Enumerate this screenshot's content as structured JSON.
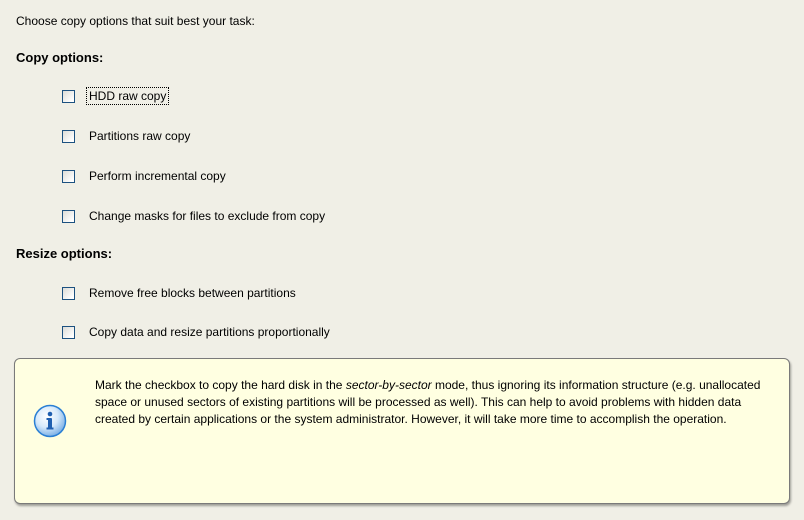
{
  "intro": "Choose copy options that suit best your task:",
  "copy_section": {
    "title": "Copy options:",
    "options": [
      {
        "label": "HDD raw copy",
        "checked": false,
        "focused": true
      },
      {
        "label": "Partitions raw copy",
        "checked": false,
        "focused": false
      },
      {
        "label": "Perform incremental copy",
        "checked": false,
        "focused": false
      },
      {
        "label": "Change masks for files to exclude from copy",
        "checked": false,
        "focused": false
      }
    ]
  },
  "resize_section": {
    "title": "Resize options:",
    "options": [
      {
        "label": "Remove free blocks between partitions",
        "checked": false,
        "focused": false
      },
      {
        "label": "Copy data and resize partitions proportionally",
        "checked": false,
        "focused": false
      }
    ]
  },
  "info": {
    "icon": "info-icon",
    "text_before": "Mark the checkbox to copy the hard disk in the ",
    "text_emphasis": "sector-by-sector",
    "text_after": " mode, thus ignoring its information structure (e.g. unallocated space or unused sectors of existing partitions will be processed as well). This can help to avoid problems with hidden data created by certain applications or the system administrator. However, it will take more time to accomplish the operation."
  },
  "colors": {
    "background": "#f0efe6",
    "info_background": "#ffffe1",
    "checkbox_border": "#1c5180",
    "info_icon_blue": "#2a7fd4"
  }
}
